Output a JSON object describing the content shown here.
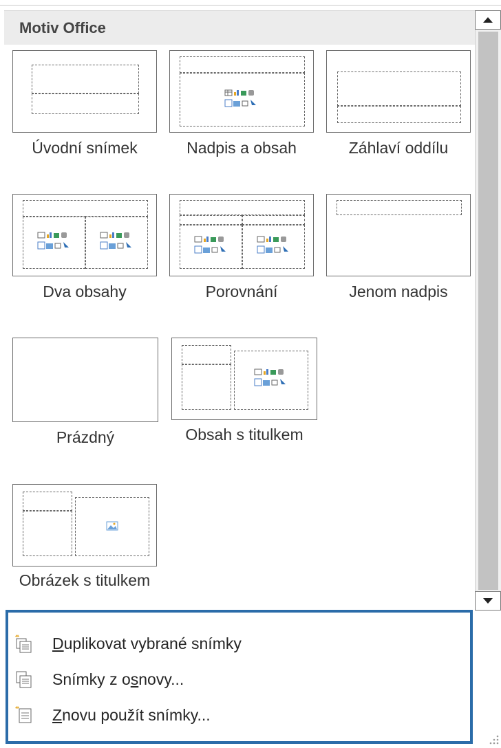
{
  "gallery": {
    "section_title": "Motiv Office",
    "layouts": [
      {
        "id": "title-slide",
        "label": "Úvodní snímek"
      },
      {
        "id": "title-content",
        "label": "Nadpis a obsah"
      },
      {
        "id": "section-header",
        "label": "Záhlaví oddílu"
      },
      {
        "id": "two-content",
        "label": "Dva obsahy"
      },
      {
        "id": "comparison",
        "label": "Porovnání"
      },
      {
        "id": "title-only",
        "label": "Jenom nadpis"
      },
      {
        "id": "blank",
        "label": "Prázdný"
      },
      {
        "id": "content-caption",
        "label": "Obsah s titulkem"
      },
      {
        "id": "picture-caption",
        "label": "Obrázek s titulkem"
      }
    ]
  },
  "menu": {
    "items": [
      {
        "label_prefix": "",
        "label_key": "D",
        "label_rest": "uplikovat vybrané snímky",
        "icon": "duplicate-slides-icon"
      },
      {
        "label_prefix": "Snímky z o",
        "label_key": "s",
        "label_rest": "novy...",
        "icon": "slides-from-outline-icon"
      },
      {
        "label_prefix": "",
        "label_key": "Z",
        "label_rest": "novu použít snímky...",
        "icon": "reuse-slides-icon"
      }
    ]
  },
  "colors": {
    "accent_border": "#2b6ca9",
    "header_bg": "#ececec",
    "scroll_thumb": "#c2c2c2"
  }
}
